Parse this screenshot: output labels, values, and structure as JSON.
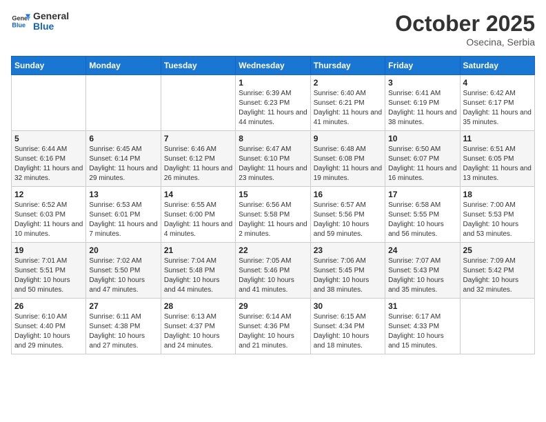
{
  "header": {
    "logo_general": "General",
    "logo_blue": "Blue",
    "month_title": "October 2025",
    "location": "Osecina, Serbia"
  },
  "weekdays": [
    "Sunday",
    "Monday",
    "Tuesday",
    "Wednesday",
    "Thursday",
    "Friday",
    "Saturday"
  ],
  "weeks": [
    [
      {
        "day": "",
        "sunrise": "",
        "sunset": "",
        "daylight": ""
      },
      {
        "day": "",
        "sunrise": "",
        "sunset": "",
        "daylight": ""
      },
      {
        "day": "",
        "sunrise": "",
        "sunset": "",
        "daylight": ""
      },
      {
        "day": "1",
        "sunrise": "Sunrise: 6:39 AM",
        "sunset": "Sunset: 6:23 PM",
        "daylight": "Daylight: 11 hours and 44 minutes."
      },
      {
        "day": "2",
        "sunrise": "Sunrise: 6:40 AM",
        "sunset": "Sunset: 6:21 PM",
        "daylight": "Daylight: 11 hours and 41 minutes."
      },
      {
        "day": "3",
        "sunrise": "Sunrise: 6:41 AM",
        "sunset": "Sunset: 6:19 PM",
        "daylight": "Daylight: 11 hours and 38 minutes."
      },
      {
        "day": "4",
        "sunrise": "Sunrise: 6:42 AM",
        "sunset": "Sunset: 6:17 PM",
        "daylight": "Daylight: 11 hours and 35 minutes."
      }
    ],
    [
      {
        "day": "5",
        "sunrise": "Sunrise: 6:44 AM",
        "sunset": "Sunset: 6:16 PM",
        "daylight": "Daylight: 11 hours and 32 minutes."
      },
      {
        "day": "6",
        "sunrise": "Sunrise: 6:45 AM",
        "sunset": "Sunset: 6:14 PM",
        "daylight": "Daylight: 11 hours and 29 minutes."
      },
      {
        "day": "7",
        "sunrise": "Sunrise: 6:46 AM",
        "sunset": "Sunset: 6:12 PM",
        "daylight": "Daylight: 11 hours and 26 minutes."
      },
      {
        "day": "8",
        "sunrise": "Sunrise: 6:47 AM",
        "sunset": "Sunset: 6:10 PM",
        "daylight": "Daylight: 11 hours and 23 minutes."
      },
      {
        "day": "9",
        "sunrise": "Sunrise: 6:48 AM",
        "sunset": "Sunset: 6:08 PM",
        "daylight": "Daylight: 11 hours and 19 minutes."
      },
      {
        "day": "10",
        "sunrise": "Sunrise: 6:50 AM",
        "sunset": "Sunset: 6:07 PM",
        "daylight": "Daylight: 11 hours and 16 minutes."
      },
      {
        "day": "11",
        "sunrise": "Sunrise: 6:51 AM",
        "sunset": "Sunset: 6:05 PM",
        "daylight": "Daylight: 11 hours and 13 minutes."
      }
    ],
    [
      {
        "day": "12",
        "sunrise": "Sunrise: 6:52 AM",
        "sunset": "Sunset: 6:03 PM",
        "daylight": "Daylight: 11 hours and 10 minutes."
      },
      {
        "day": "13",
        "sunrise": "Sunrise: 6:53 AM",
        "sunset": "Sunset: 6:01 PM",
        "daylight": "Daylight: 11 hours and 7 minutes."
      },
      {
        "day": "14",
        "sunrise": "Sunrise: 6:55 AM",
        "sunset": "Sunset: 6:00 PM",
        "daylight": "Daylight: 11 hours and 4 minutes."
      },
      {
        "day": "15",
        "sunrise": "Sunrise: 6:56 AM",
        "sunset": "Sunset: 5:58 PM",
        "daylight": "Daylight: 11 hours and 2 minutes."
      },
      {
        "day": "16",
        "sunrise": "Sunrise: 6:57 AM",
        "sunset": "Sunset: 5:56 PM",
        "daylight": "Daylight: 10 hours and 59 minutes."
      },
      {
        "day": "17",
        "sunrise": "Sunrise: 6:58 AM",
        "sunset": "Sunset: 5:55 PM",
        "daylight": "Daylight: 10 hours and 56 minutes."
      },
      {
        "day": "18",
        "sunrise": "Sunrise: 7:00 AM",
        "sunset": "Sunset: 5:53 PM",
        "daylight": "Daylight: 10 hours and 53 minutes."
      }
    ],
    [
      {
        "day": "19",
        "sunrise": "Sunrise: 7:01 AM",
        "sunset": "Sunset: 5:51 PM",
        "daylight": "Daylight: 10 hours and 50 minutes."
      },
      {
        "day": "20",
        "sunrise": "Sunrise: 7:02 AM",
        "sunset": "Sunset: 5:50 PM",
        "daylight": "Daylight: 10 hours and 47 minutes."
      },
      {
        "day": "21",
        "sunrise": "Sunrise: 7:04 AM",
        "sunset": "Sunset: 5:48 PM",
        "daylight": "Daylight: 10 hours and 44 minutes."
      },
      {
        "day": "22",
        "sunrise": "Sunrise: 7:05 AM",
        "sunset": "Sunset: 5:46 PM",
        "daylight": "Daylight: 10 hours and 41 minutes."
      },
      {
        "day": "23",
        "sunrise": "Sunrise: 7:06 AM",
        "sunset": "Sunset: 5:45 PM",
        "daylight": "Daylight: 10 hours and 38 minutes."
      },
      {
        "day": "24",
        "sunrise": "Sunrise: 7:07 AM",
        "sunset": "Sunset: 5:43 PM",
        "daylight": "Daylight: 10 hours and 35 minutes."
      },
      {
        "day": "25",
        "sunrise": "Sunrise: 7:09 AM",
        "sunset": "Sunset: 5:42 PM",
        "daylight": "Daylight: 10 hours and 32 minutes."
      }
    ],
    [
      {
        "day": "26",
        "sunrise": "Sunrise: 6:10 AM",
        "sunset": "Sunset: 4:40 PM",
        "daylight": "Daylight: 10 hours and 29 minutes."
      },
      {
        "day": "27",
        "sunrise": "Sunrise: 6:11 AM",
        "sunset": "Sunset: 4:38 PM",
        "daylight": "Daylight: 10 hours and 27 minutes."
      },
      {
        "day": "28",
        "sunrise": "Sunrise: 6:13 AM",
        "sunset": "Sunset: 4:37 PM",
        "daylight": "Daylight: 10 hours and 24 minutes."
      },
      {
        "day": "29",
        "sunrise": "Sunrise: 6:14 AM",
        "sunset": "Sunset: 4:36 PM",
        "daylight": "Daylight: 10 hours and 21 minutes."
      },
      {
        "day": "30",
        "sunrise": "Sunrise: 6:15 AM",
        "sunset": "Sunset: 4:34 PM",
        "daylight": "Daylight: 10 hours and 18 minutes."
      },
      {
        "day": "31",
        "sunrise": "Sunrise: 6:17 AM",
        "sunset": "Sunset: 4:33 PM",
        "daylight": "Daylight: 10 hours and 15 minutes."
      },
      {
        "day": "",
        "sunrise": "",
        "sunset": "",
        "daylight": ""
      }
    ]
  ]
}
